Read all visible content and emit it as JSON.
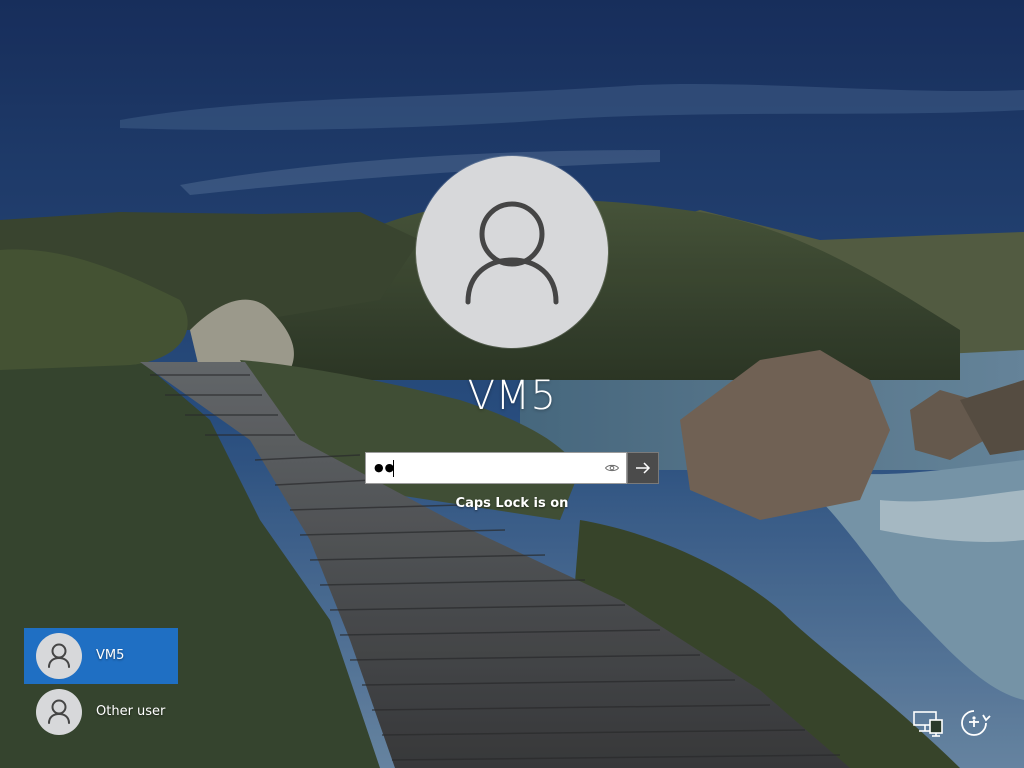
{
  "account": {
    "display_name": "VM5"
  },
  "password": {
    "masked": "●●"
  },
  "caps_lock_warning": "Caps Lock is on",
  "user_list": [
    {
      "label": "VM5",
      "selected": true
    },
    {
      "label": "Other user",
      "selected": false
    }
  ],
  "icons": {
    "avatar": "user-silhouette-icon",
    "reveal": "eye-icon",
    "submit": "arrow-right-icon",
    "network": "network-icon",
    "ease_of_access": "ease-of-access-icon"
  },
  "colors": {
    "selected_tile": "#1f6fc3",
    "submit_button": "#4b4b4b",
    "avatar_background": "#d7d8da"
  }
}
